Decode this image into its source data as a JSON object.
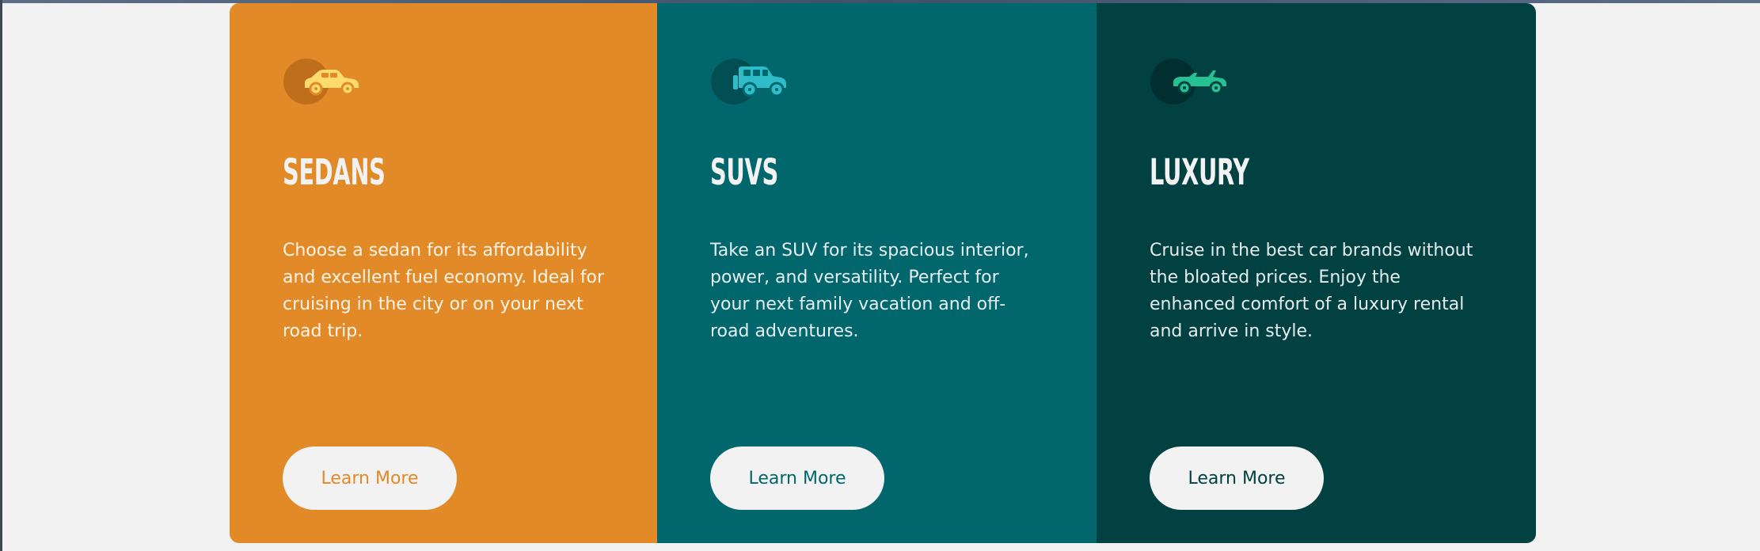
{
  "colors": {
    "page_background": "#f2f2f2",
    "sedans_card": "#e28a27",
    "suvs_card": "#02666d",
    "luxury_card": "#014142",
    "button_background": "#f2f2f2",
    "title_text": "#f2f2f2"
  },
  "cards": [
    {
      "icon": "sedan-icon",
      "title": "SEDANS",
      "description": "Choose a sedan for its affordability and excellent fuel economy. Ideal for cruising in the city or on your next road trip.",
      "button_label": "Learn More"
    },
    {
      "icon": "suv-icon",
      "title": "SUVS",
      "description": "Take an SUV for its spacious interior, power, and versatility. Perfect for your next family vacation and off-road adventures.",
      "button_label": "Learn More"
    },
    {
      "icon": "luxury-car-icon",
      "title": "LUXURY",
      "description": "Cruise in the best car brands without the bloated prices. Enjoy the enhanced comfort of a luxury rental and arrive in style.",
      "button_label": "Learn More"
    }
  ]
}
